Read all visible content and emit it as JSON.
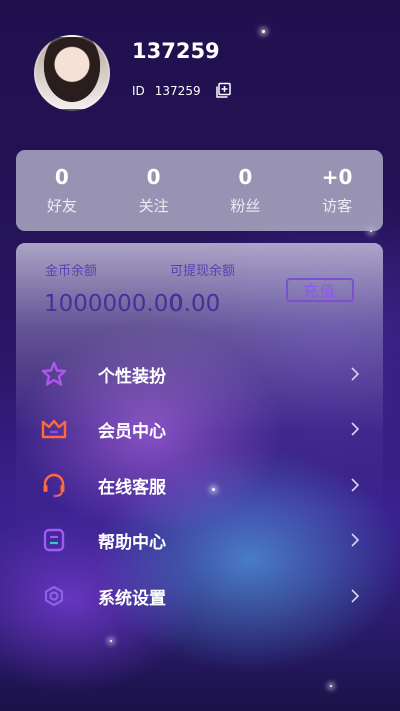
{
  "profile": {
    "username": "137259",
    "id_label": "ID",
    "id_value": "137259"
  },
  "stats": [
    {
      "value": "0",
      "label": "好友"
    },
    {
      "value": "0",
      "label": "关注"
    },
    {
      "value": "0",
      "label": "粉丝"
    },
    {
      "value": "+0",
      "label": "访客"
    }
  ],
  "balance": {
    "gold_label": "金币余额",
    "gold_value": "1000000.00",
    "withdraw_label": "可提现余额",
    "withdraw_value": "0.00",
    "recharge_label": "充值"
  },
  "menu": [
    {
      "label": "个性装扮",
      "icon": "star-icon",
      "color": "#b056f0"
    },
    {
      "label": "会员中心",
      "icon": "crown-icon",
      "color": "#ff6a3c"
    },
    {
      "label": "在线客服",
      "icon": "headset-icon",
      "color": "#ff6a3c"
    },
    {
      "label": "帮助中心",
      "icon": "help-doc-icon",
      "color": "#9c5cf5"
    },
    {
      "label": "系统设置",
      "icon": "gear-icon",
      "color": "#8a63e6"
    }
  ],
  "colors": {
    "accent": "#7a4fd0",
    "background": "#231356"
  }
}
